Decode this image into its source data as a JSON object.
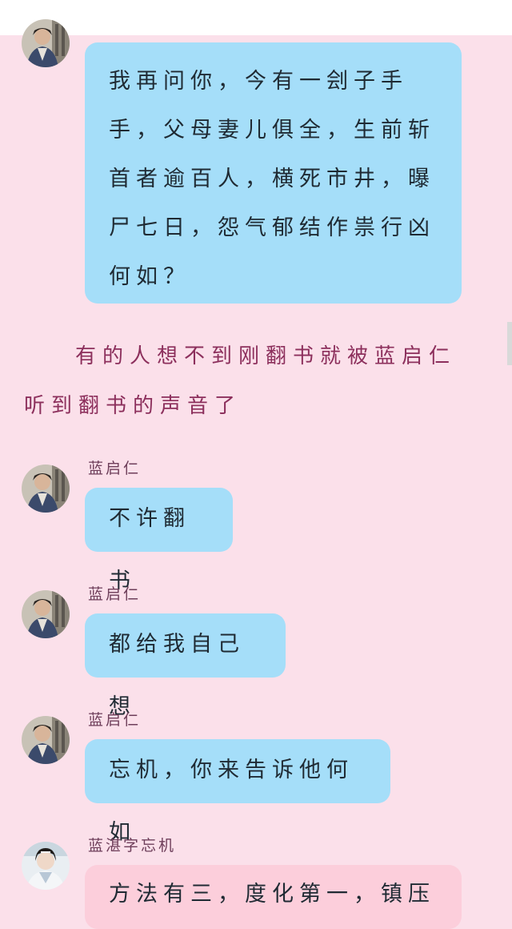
{
  "messages": [
    {
      "sender": "",
      "text": "我再问你，今有一刽子手手，父母妻儿俱全，生前斩首者逾百人，横死市井，曝尸七日，怨气郁结作祟行凶何如？",
      "style": "blue"
    },
    {
      "sender": "蓝启仁",
      "text": "不许翻书",
      "style": "blue"
    },
    {
      "sender": "蓝启仁",
      "text": "都给我自己想",
      "style": "blue"
    },
    {
      "sender": "蓝启仁",
      "text": "忘机，你来告诉他何如",
      "style": "blue"
    },
    {
      "sender": "蓝湛字忘机",
      "text": "方法有三，度化第一，镇压",
      "style": "pink"
    }
  ],
  "narration": "有的人想不到刚翻书就被蓝启仁听到翻书的声音了",
  "avatars": {
    "lan_qiren": "elder-avatar-icon",
    "lan_zhan": "young-man-avatar-icon"
  },
  "colors": {
    "background": "#fbe0ea",
    "blue_bubble": "#a5def9",
    "pink_bubble": "#fccedb",
    "narration_text": "#8c2f5c",
    "sender_text": "#6e3e5a"
  }
}
